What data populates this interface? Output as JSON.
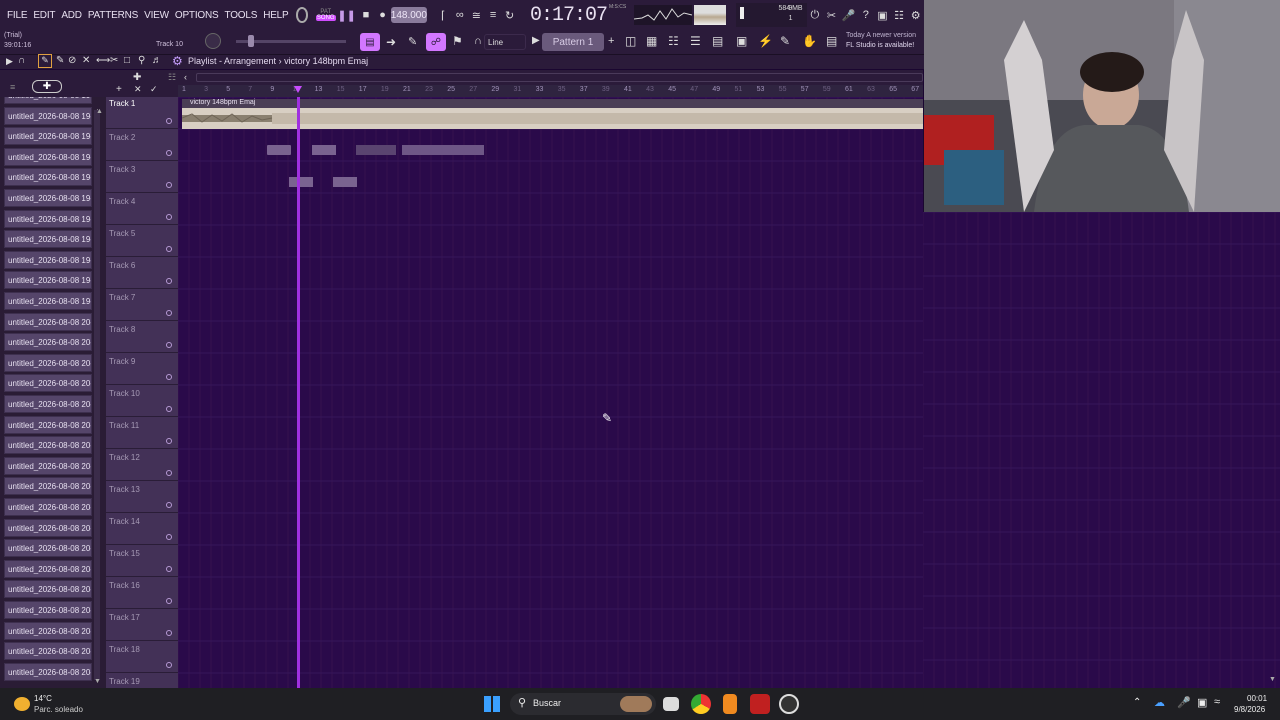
{
  "menu": [
    "FILE",
    "EDIT",
    "ADD",
    "PATTERNS",
    "VIEW",
    "OPTIONS",
    "TOOLS",
    "HELP"
  ],
  "transport": {
    "mode_top": "PAT",
    "mode_bottom": "SONG",
    "tempo": "148.000",
    "time": "0:17:07",
    "time_unit": "M:S:CS"
  },
  "status": {
    "trial": "(Trial)",
    "position": "39:01:16",
    "hint_track": "Track 10"
  },
  "cpu": {
    "ram": "584 MB",
    "voices": "1",
    "cpu_num": "9"
  },
  "news": {
    "line1": "Today  A newer version",
    "line2": "FL Studio is available!"
  },
  "snap": {
    "label": "Line"
  },
  "pattern": {
    "label": "Pattern 1"
  },
  "playlist": {
    "breadcrumb_prefix": "Playlist",
    "breadcrumb_sep": " - ",
    "breadcrumb_title": "Arrangement",
    "breadcrumb_sep2": " › ",
    "breadcrumb_clip": "victory 148bpm Emaj"
  },
  "clip": {
    "name": "victory 148bpm Emaj"
  },
  "ruler_ticks": [
    "1",
    "5",
    "9",
    "13",
    "17",
    "21",
    "25",
    "29",
    "33",
    "37",
    "41",
    "45",
    "49",
    "53",
    "57",
    "61",
    "65",
    "67"
  ],
  "ruler_minor": [
    "3",
    "7",
    "11",
    "15",
    "19",
    "23",
    "27",
    "31",
    "35",
    "39",
    "43",
    "47",
    "51",
    "55",
    "59",
    "63"
  ],
  "browser_items": [
    "untitled_2026-08-08 19-",
    "untitled_2026-08-08 19-",
    "untitled_2026-08-08 19-",
    "untitled_2026-08-08 19-",
    "untitled_2026-08-08 19-",
    "untitled_2026-08-08 19-",
    "untitled_2026-08-08 19-",
    "untitled_2026-08-08 19-",
    "untitled_2026-08-08 19-",
    "untitled_2026-08-08 19-",
    "untitled_2026-08-08 19-",
    "untitled_2026-08-08 20-",
    "untitled_2026-08-08 20-",
    "untitled_2026-08-08 20-",
    "untitled_2026-08-08 20-",
    "untitled_2026-08-08 20-",
    "untitled_2026-08-08 20-",
    "untitled_2026-08-08 20-",
    "untitled_2026-08-08 20-",
    "untitled_2026-08-08 20-",
    "untitled_2026-08-08 20-",
    "untitled_2026-08-08 20-",
    "untitled_2026-08-08 20-",
    "untitled_2026-08-08 20-",
    "untitled_2026-08-08 20-",
    "untitled_2026-08-08 20-",
    "untitled_2026-08-08 20-",
    "untitled_2026-08-08 20-",
    "untitled_2026-08-08 20-"
  ],
  "tracks": [
    "Track 1",
    "Track 2",
    "Track 3",
    "Track 4",
    "Track 5",
    "Track 6",
    "Track 7",
    "Track 8",
    "Track 9",
    "Track 10",
    "Track 11",
    "Track 12",
    "Track 13",
    "Track 14",
    "Track 15",
    "Track 16",
    "Track 17",
    "Track 18",
    "Track 19"
  ],
  "taskbar": {
    "weather_temp": "14°C",
    "weather_desc": "Parc. soleado",
    "search": "Buscar",
    "clock_time": "00:01",
    "clock_date": "9/8/2026"
  },
  "colors": {
    "accent": "#c84cff",
    "playlist_bg": "#2a0a4a",
    "toolbar": "#2b1b3a",
    "clip": "#d8cfc3"
  }
}
